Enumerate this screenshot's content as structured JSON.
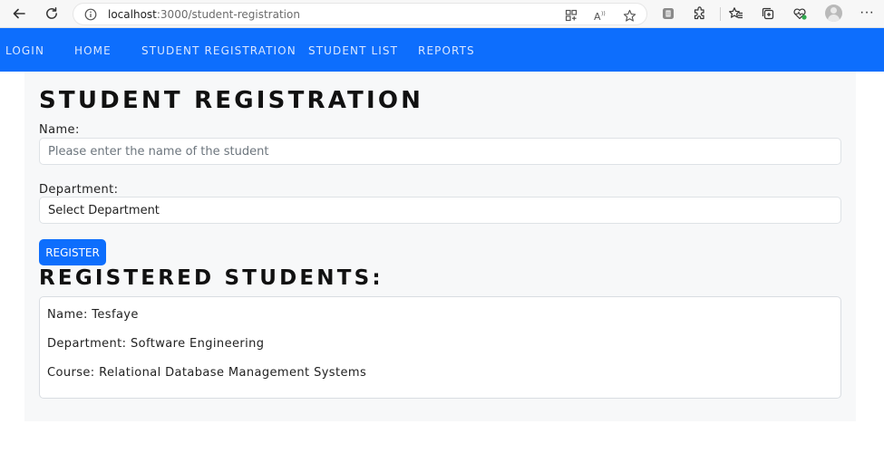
{
  "browser": {
    "url_host": "localhost",
    "url_path": ":3000/student-registration",
    "icons": [
      "back-icon",
      "refresh-icon",
      "info-icon",
      "app-grid-icon",
      "read-aloud-icon",
      "favorite-star-icon",
      "extension-badge-icon",
      "extensions-icon",
      "favorites-icon",
      "collections-icon",
      "health-icon",
      "profile-avatar",
      "more-icon"
    ],
    "more_label": "···"
  },
  "navbar": {
    "items": [
      {
        "label": "LOGIN"
      },
      {
        "label": "HOME"
      },
      {
        "label": "STUDENT REGISTRATION"
      },
      {
        "label": "STUDENT LIST"
      },
      {
        "label": "REPORTS"
      }
    ]
  },
  "form": {
    "title": "STUDENT REGISTRATION",
    "name_label": "Name:",
    "name_placeholder": "Please enter the name of the student",
    "name_value": "",
    "department_label": "Department:",
    "department_value": "Select Department",
    "submit_label": "REGISTER"
  },
  "registered": {
    "title": "REGISTERED STUDENTS:",
    "students": [
      {
        "name_line": "Name: Tesfaye",
        "department_line": "Department: Software Engineering",
        "course_line": "Course: Relational Database Management Systems"
      }
    ]
  },
  "colors": {
    "primary": "#0d6efd",
    "panel_bg": "#f7f8f9",
    "text": "#111111"
  }
}
